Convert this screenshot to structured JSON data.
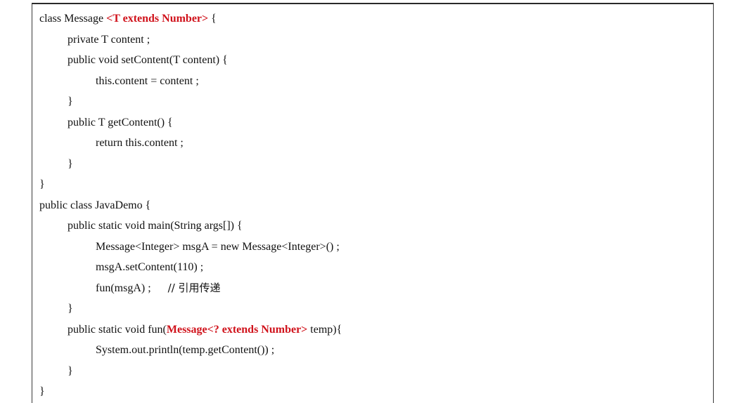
{
  "document": {
    "code_lines": [
      {
        "indent": 0,
        "parts": [
          {
            "text": "class Message "
          },
          {
            "text": "<T extends Number>",
            "highlight": true
          },
          {
            "text": " {"
          }
        ]
      },
      {
        "indent": 1,
        "parts": [
          {
            "text": "private T content ;"
          }
        ]
      },
      {
        "indent": 1,
        "parts": [
          {
            "text": "public void setContent(T content) {"
          }
        ]
      },
      {
        "indent": 2,
        "parts": [
          {
            "text": "this.content = content ;"
          }
        ]
      },
      {
        "indent": 1,
        "parts": [
          {
            "text": "}"
          }
        ]
      },
      {
        "indent": 1,
        "parts": [
          {
            "text": "public T getContent() {"
          }
        ]
      },
      {
        "indent": 2,
        "parts": [
          {
            "text": "return this.content ;"
          }
        ]
      },
      {
        "indent": 1,
        "parts": [
          {
            "text": "}"
          }
        ]
      },
      {
        "indent": 0,
        "parts": [
          {
            "text": "}"
          }
        ]
      },
      {
        "indent": 0,
        "parts": [
          {
            "text": "public class JavaDemo {"
          }
        ]
      },
      {
        "indent": 1,
        "parts": [
          {
            "text": "public static void main(String args[]) {"
          }
        ]
      },
      {
        "indent": 2,
        "parts": [
          {
            "text": "Message<Integer> msgA = new Message<Integer>() ;"
          }
        ]
      },
      {
        "indent": 2,
        "parts": [
          {
            "text": "msgA.setContent(110) ;"
          }
        ]
      },
      {
        "indent": 2,
        "parts": [
          {
            "text": "fun(msgA) ;      "
          },
          {
            "text": "// 引用传递",
            "comment": true
          }
        ]
      },
      {
        "indent": 1,
        "parts": [
          {
            "text": "}"
          }
        ]
      },
      {
        "indent": 1,
        "parts": [
          {
            "text": "public static void fun("
          },
          {
            "text": "Message<? extends Number>",
            "highlight": true
          },
          {
            "text": " temp){"
          }
        ]
      },
      {
        "indent": 2,
        "parts": [
          {
            "text": "System.out.println(temp.getContent()) ;"
          }
        ]
      },
      {
        "indent": 1,
        "parts": [
          {
            "text": "}"
          }
        ]
      },
      {
        "indent": 0,
        "parts": [
          {
            "text": "}"
          }
        ]
      }
    ]
  },
  "colors": {
    "highlight": "#d0121b",
    "text": "#111111",
    "border": "#2a2a2a"
  }
}
